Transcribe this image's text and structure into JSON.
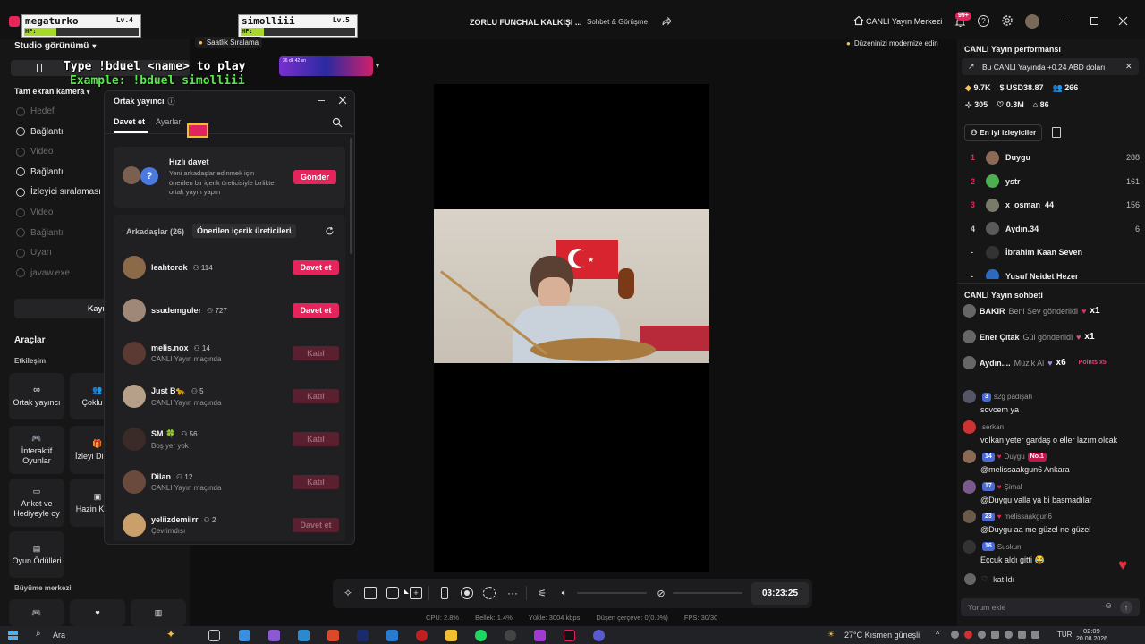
{
  "titlebar": {
    "game_player1": {
      "name": "megaturko",
      "level": "Lv.4",
      "hp": "HP:"
    },
    "game_player2": {
      "name": "simolliii",
      "level": "Lv.5",
      "hp": "HP:"
    },
    "title": "ZORLU FUNCHAL KALKIŞI ...",
    "category": "Sohbet & Görüşme",
    "live_center": "CANLI Yayın Merkezi",
    "notif_count": "99+"
  },
  "overlay": {
    "hourly": "Saatlik Sıralama",
    "hourly_time": "36 dk 42 sn",
    "bduel": "Type !bduel <name> to play",
    "example": "Example: !bduel simolliii"
  },
  "modernize": "Düzeninizi modernize edin",
  "left": {
    "studio_view": "Studio görünümü",
    "fullscreen": "Tam ekran kamera",
    "sources": [
      {
        "label": "Hedef",
        "dim": true
      },
      {
        "label": "Bağlantı",
        "dim": false
      },
      {
        "label": "Video",
        "dim": true
      },
      {
        "label": "Bağlantı",
        "dim": false
      },
      {
        "label": "İzleyici sıralaması",
        "dim": false
      },
      {
        "label": "Video",
        "dim": true
      },
      {
        "label": "Bağlantı",
        "dim": true
      },
      {
        "label": "Uyarı",
        "dim": true
      },
      {
        "label": "javaw.exe",
        "dim": true
      }
    ],
    "source_btn": "Kaynak",
    "tools": "Araçlar",
    "interaction": "Etkileşim",
    "tiles": [
      "Ortak yayıncı",
      "Çoklu ko",
      "İnteraktif Oyunlar",
      "İzleyi Dilekle",
      "Anket ve Hediyeyle oy",
      "Hazin Kutus",
      "Oyun Ödülleri"
    ],
    "growth": "Büyüme merkezi"
  },
  "cohost": {
    "title": "Ortak yayıncı",
    "tab_invite": "Davet et",
    "tab_settings": "Ayarlar",
    "quick_title": "Hızlı davet",
    "quick_desc": "Yeni arkadaşlar edinmek için önerilen bir içerik üreticisiyle birlikte ortak yayın yapın",
    "send": "Gönder",
    "friends_tab": "Arkadaşlar (26)",
    "suggested_tab": "Önerilen içerik üreticileri",
    "friends": [
      {
        "name": "leahtorok",
        "count": "114",
        "sub": "",
        "btn": "Davet et",
        "active": true,
        "color": "#8b6a4a"
      },
      {
        "name": "ssudemguler",
        "count": "727",
        "sub": "",
        "btn": "Davet et",
        "active": true,
        "color": "#a08878"
      },
      {
        "name": "melis.nox",
        "count": "14",
        "sub": "CANLI Yayın maçında",
        "btn": "Katıl",
        "active": false,
        "color": "#5a3a32"
      },
      {
        "name": "Just B🐆",
        "count": "5",
        "sub": "CANLI Yayın maçında",
        "btn": "Katıl",
        "active": false,
        "color": "#b7a08a"
      },
      {
        "name": "SM 🍀",
        "count": "56",
        "sub": "Boş yer yok",
        "btn": "Katıl",
        "active": false,
        "color": "#3a2a28"
      },
      {
        "name": "Dilan",
        "count": "12",
        "sub": "CANLI Yayın maçında",
        "btn": "Katıl",
        "active": false,
        "color": "#6b4a3e"
      },
      {
        "name": "yeliizdemiirr",
        "count": "2",
        "sub": "Çevrimdışı",
        "btn": "Davet et",
        "active": false,
        "color": "#c9a06a"
      }
    ]
  },
  "toolbar": {
    "timer": "03:23:25",
    "status": [
      {
        "label": "CPU: 2.8%"
      },
      {
        "label": "Bellek: 1.4%"
      },
      {
        "label": "Yükle: 3004 kbps"
      },
      {
        "label": "Düşen çerçeve: 0(0.0%)"
      },
      {
        "label": "FPS: 30/30"
      }
    ]
  },
  "right": {
    "perf_title": "CANLI Yayın performansı",
    "perf_banner": "Bu CANLI Yayında +0.24 ABD doları",
    "stats": [
      "9.7K",
      "USD38.87",
      "266",
      "305",
      "0.3M",
      "86"
    ],
    "top_viewers": "En iyi izleyiciler",
    "ranking": [
      {
        "rank": "1",
        "name": "Duygu",
        "score": "288",
        "color": "#8a6a55"
      },
      {
        "rank": "2",
        "name": "ystr",
        "score": "161",
        "color": "#4caf50"
      },
      {
        "rank": "3",
        "name": "x_osman_44",
        "score": "156",
        "color": "#7a7a6a"
      },
      {
        "rank": "4",
        "name": "Aydın.34",
        "score": "6",
        "color": "#5a5a5a"
      },
      {
        "rank": "-",
        "name": "İbrahim Kaan Seven",
        "score": "",
        "color": "#333"
      },
      {
        "rank": "-",
        "name": "Yusuf Nejdet Hezer",
        "score": "",
        "color": "#2a6ac0"
      }
    ],
    "chat_title": "CANLI Yayın sohbeti",
    "gifts": [
      {
        "user": "BAKIR",
        "text": "Beni Sev gönderildi",
        "mult": "x1"
      },
      {
        "user": "Ener Çıtak",
        "text": "Gül gönderildi",
        "mult": "x1"
      },
      {
        "user": "Aydın....",
        "text": "Müzik Al",
        "mult": "x6",
        "extra": "Points x5"
      }
    ],
    "messages": [
      {
        "level": "3",
        "user": "s2g padişah",
        "text": "sovcem ya",
        "badge": "",
        "color": "#556"
      },
      {
        "level": "",
        "user": "serkan",
        "text": "volkan yeter gardaş o eller lazım olcak",
        "badge": "",
        "color": "#c33"
      },
      {
        "level": "14",
        "user": "Duygu",
        "text": "@melissaakgun6 Ankara",
        "badge": "No.1",
        "color": "#8a6a55"
      },
      {
        "level": "17",
        "user": "Şimal",
        "text": "@Duygu valla ya bi basmadılar",
        "badge": "",
        "color": "#7a5a8a"
      },
      {
        "level": "23",
        "user": "melissaakgun6",
        "text": "@Duygu aa me güzel ne güzel",
        "badge": "",
        "color": "#6a5a4a"
      },
      {
        "level": "16",
        "user": "Suskun",
        "text": "Eccuk aldı gitti 😂",
        "badge": "",
        "color": "#333"
      }
    ],
    "joined": "katıldı",
    "comment_placeholder": "Yorum ekle"
  },
  "taskbar": {
    "search": "Ara",
    "weather": "27°C  Kısmen güneşli",
    "lang": "TUR",
    "time": "02:09",
    "date": "20.08.2026"
  }
}
